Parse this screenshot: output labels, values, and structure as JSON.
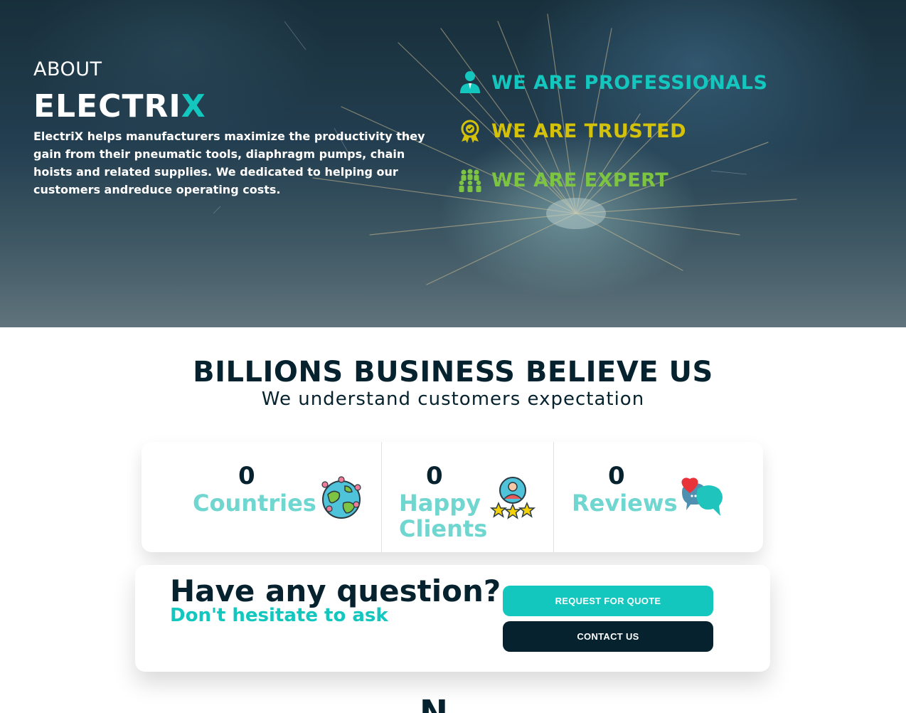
{
  "about": {
    "label": "ABOUT",
    "brand_main": "ELECTRI",
    "brand_accent": "X",
    "description": "ElectriX helps manufacturers maximize the productivity they gain from their pneumatic tools, diaphragm pumps, chain hoists and related supplies. We dedicated to helping our customers andreduce operating costs."
  },
  "features": [
    {
      "label": "WE ARE PROFESSIONALS",
      "icon": "professional-person-icon",
      "color": "#13c7bf"
    },
    {
      "label": "WE ARE TRUSTED",
      "icon": "award-badge-icon",
      "color": "#d4c10a"
    },
    {
      "label": "WE ARE EXPERT",
      "icon": "team-group-icon",
      "color": "#7cc442"
    }
  ],
  "believe": {
    "title": "BILLIONS BUSINESS BELIEVE US",
    "subtitle": "We understand customers expectation"
  },
  "stats": [
    {
      "value": "0",
      "label": "Countries",
      "icon": "globe-pins-icon"
    },
    {
      "value": "0",
      "label": "Happy Clients",
      "icon": "client-stars-icon"
    },
    {
      "value": "0",
      "label": "Reviews",
      "icon": "chat-heart-icon"
    }
  ],
  "question": {
    "title": "Have any question?",
    "subtitle": "Don't hesitate to ask",
    "quote_button": "REQUEST FOR QUOTE",
    "contact_button": "CONTACT US"
  },
  "next_section_peek": "N",
  "colors": {
    "accent": "#13c7bf",
    "dark": "#05222e",
    "stat_label": "#6fd6d0",
    "trusted": "#d4c10a",
    "expert": "#7cc442"
  }
}
